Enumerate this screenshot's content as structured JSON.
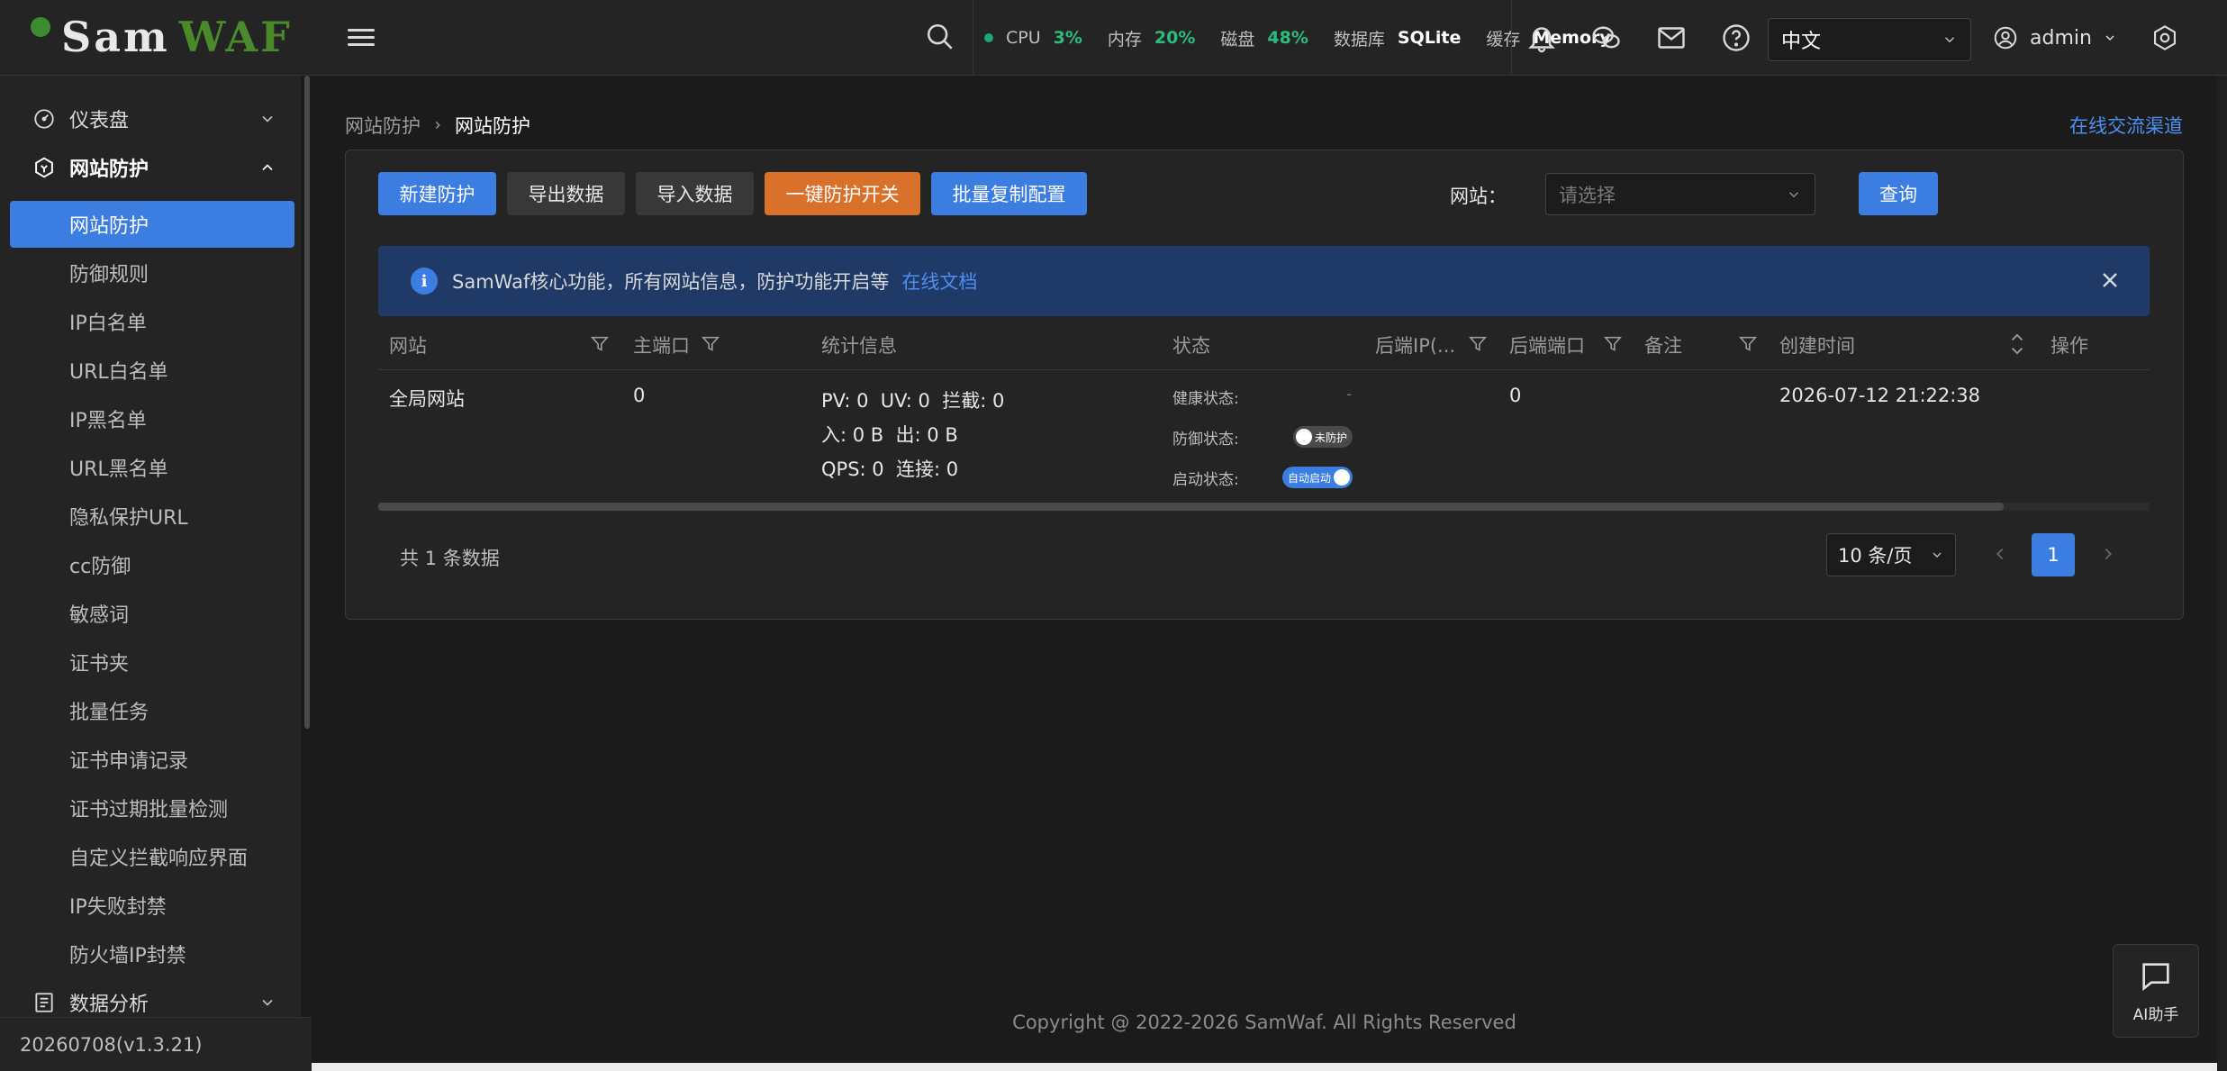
{
  "header": {
    "logo": {
      "part1": "Sam",
      "part2": "WAF"
    },
    "stats": [
      {
        "label": "CPU",
        "value": "3%"
      },
      {
        "label": "内存",
        "value": "20%"
      },
      {
        "label": "磁盘",
        "value": "48%"
      }
    ],
    "db": {
      "label": "数据库",
      "value": "SQLite"
    },
    "cache": {
      "label": "缓存",
      "value": "Memory"
    },
    "language": "中文",
    "user": "admin"
  },
  "sidebar": {
    "items": [
      {
        "label": "仪表盘",
        "type": "group",
        "icon": "dashboard-icon"
      },
      {
        "label": "网站防护",
        "type": "group-open",
        "icon": "shield-icon"
      },
      {
        "label": "网站防护",
        "type": "sub-active"
      },
      {
        "label": "防御规则",
        "type": "sub"
      },
      {
        "label": "IP白名单",
        "type": "sub"
      },
      {
        "label": "URL白名单",
        "type": "sub"
      },
      {
        "label": "IP黑名单",
        "type": "sub"
      },
      {
        "label": "URL黑名单",
        "type": "sub"
      },
      {
        "label": "隐私保护URL",
        "type": "sub"
      },
      {
        "label": "cc防御",
        "type": "sub"
      },
      {
        "label": "敏感词",
        "type": "sub"
      },
      {
        "label": "证书夹",
        "type": "sub"
      },
      {
        "label": "批量任务",
        "type": "sub"
      },
      {
        "label": "证书申请记录",
        "type": "sub"
      },
      {
        "label": "证书过期批量检测",
        "type": "sub"
      },
      {
        "label": "自定义拦截响应界面",
        "type": "sub"
      },
      {
        "label": "IP失败封禁",
        "type": "sub"
      },
      {
        "label": "防火墙IP封禁",
        "type": "sub"
      },
      {
        "label": "数据分析",
        "type": "group",
        "icon": "report-icon"
      }
    ],
    "version": "20260708(v1.3.21)"
  },
  "breadcrumb": {
    "parent": "网站防护",
    "current": "网站防护"
  },
  "channel_link": "在线交流渠道",
  "toolbar": {
    "new": "新建防护",
    "export": "导出数据",
    "import": "导入数据",
    "toggle_all": "一键防护开关",
    "batch_copy": "批量复制配置",
    "site_label": "网站：",
    "site_placeholder": "请选择",
    "query": "查询"
  },
  "alert": {
    "text": "SamWaf核心功能，所有网站信息，防护功能开启等",
    "link": "在线文档"
  },
  "table": {
    "columns": [
      "网站",
      "主端口",
      "统计信息",
      "状态",
      "后端IP(...",
      "后端端口",
      "备注",
      "创建时间",
      "操作"
    ],
    "rows": [
      {
        "site": "全局网站",
        "port": "0",
        "stats_line1": "PV: 0  UV: 0  拦截: 0",
        "stats_line2": "入: 0 B  出: 0 B",
        "stats_line3": "QPS: 0  连接: 0",
        "health_label": "健康状态:",
        "health_value": "-",
        "defense_label": "防御状态:",
        "defense_switch": "未防护",
        "start_label": "启动状态:",
        "start_switch": "自动启动",
        "backend_ip": "",
        "backend_port": "0",
        "remark": "",
        "created": "2026-07-12 21:22:38"
      }
    ]
  },
  "pagination": {
    "total": "共 1 条数据",
    "page_size": "10 条/页",
    "current": "1"
  },
  "footer": {
    "copyright": "Copyright @ 2022-2026 SamWaf. All Rights Reserved"
  },
  "ai_button": "AI助手",
  "colors": {
    "primary": "#3b7de0",
    "warning": "#d9712b",
    "success": "#2bbd7e",
    "bg": "#1b1b1b",
    "panel": "#242424"
  }
}
